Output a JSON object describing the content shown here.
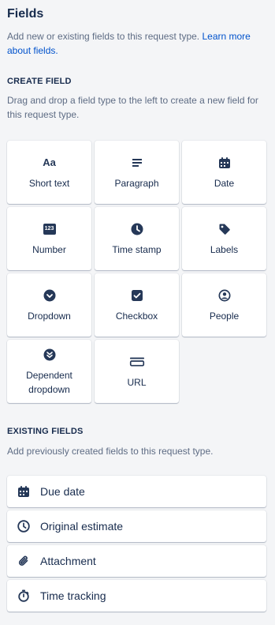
{
  "header": {
    "title": "Fields",
    "description": "Add new or existing fields to this request type.",
    "learn_more": "Learn more about fields."
  },
  "create_field": {
    "heading": "CREATE FIELD",
    "description": "Drag and drop a field type to the left to create a new field for this request type.",
    "tiles": [
      {
        "label": "Short text",
        "icon": "short-text-icon",
        "glyph": "Aa"
      },
      {
        "label": "Paragraph",
        "icon": "paragraph-icon"
      },
      {
        "label": "Date",
        "icon": "calendar-icon"
      },
      {
        "label": "Number",
        "icon": "number-icon",
        "glyph": "123"
      },
      {
        "label": "Time stamp",
        "icon": "clock-icon"
      },
      {
        "label": "Labels",
        "icon": "tag-icon"
      },
      {
        "label": "Dropdown",
        "icon": "chevron-circle-icon"
      },
      {
        "label": "Checkbox",
        "icon": "checkbox-icon"
      },
      {
        "label": "People",
        "icon": "person-circle-icon"
      },
      {
        "label": "Dependent dropdown",
        "icon": "double-chevron-circle-icon"
      },
      {
        "label": "URL",
        "icon": "url-icon"
      }
    ]
  },
  "existing_fields": {
    "heading": "EXISTING FIELDS",
    "description": "Add previously created fields to this request type.",
    "items": [
      {
        "label": "Due date",
        "icon": "calendar-icon"
      },
      {
        "label": "Original estimate",
        "icon": "clock-icon"
      },
      {
        "label": "Attachment",
        "icon": "paperclip-icon"
      },
      {
        "label": "Time tracking",
        "icon": "stopwatch-icon"
      }
    ]
  },
  "colors": {
    "background": "#f4f5f7",
    "text": "#172b4d",
    "subtle_text": "#5e6c84",
    "link": "#0052cc",
    "icon": "#253858"
  }
}
